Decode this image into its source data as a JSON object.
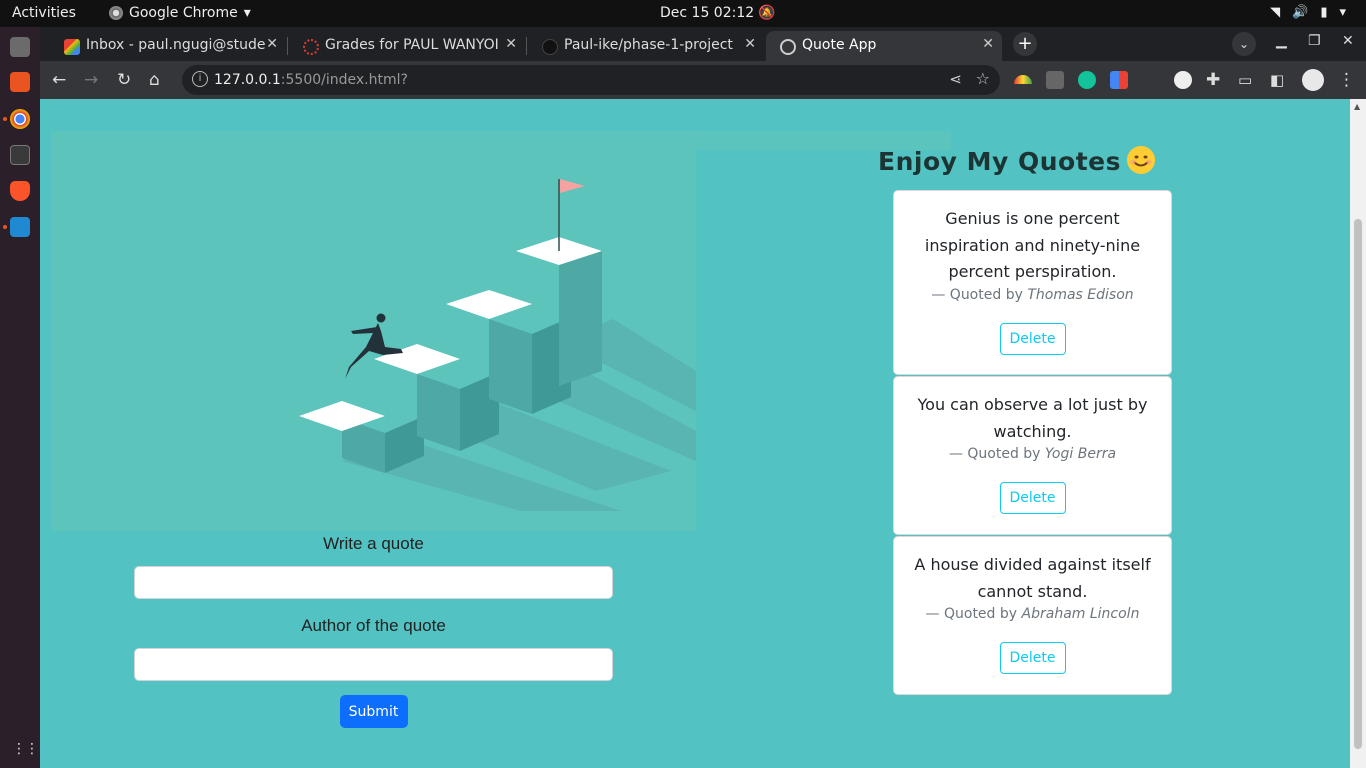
{
  "system_bar": {
    "activities": "Activities",
    "app_name": "Google Chrome",
    "clock": "Dec 15  02:12"
  },
  "browser": {
    "tabs": [
      {
        "title": "Inbox - paul.ngugi@stude",
        "favicon": "gmail-icon"
      },
      {
        "title": "Grades for PAUL WANYOI",
        "favicon": "canvas-icon"
      },
      {
        "title": "Paul-ike/phase-1-project",
        "favicon": "github-icon"
      },
      {
        "title": "Quote App",
        "favicon": "globe-icon",
        "active": true
      }
    ],
    "url_host": "127.0.0.1",
    "url_rest": ":5500/index.html?"
  },
  "page": {
    "title": "Enjoy My Quotes",
    "form": {
      "quote_label": "Write a quote",
      "author_label": "Author of the quote",
      "submit_label": "Submit"
    },
    "quotes": [
      {
        "text": "Genius is one percent inspiration and ninety-nine percent perspiration.",
        "prefix": "— Quoted by",
        "author": "Thomas Edison",
        "delete_label": "Delete"
      },
      {
        "text": "You can observe a lot just by watching.",
        "prefix": "— Quoted by",
        "author": "Yogi Berra",
        "delete_label": "Delete"
      },
      {
        "text": "A house divided against itself cannot stand.",
        "prefix": "— Quoted by",
        "author": "Abraham Lincoln",
        "delete_label": "Delete"
      }
    ]
  },
  "colors": {
    "page_bg": "#52c3c2",
    "submit_bg": "#0d6efd",
    "delete_outline": "#0dcaf0"
  }
}
